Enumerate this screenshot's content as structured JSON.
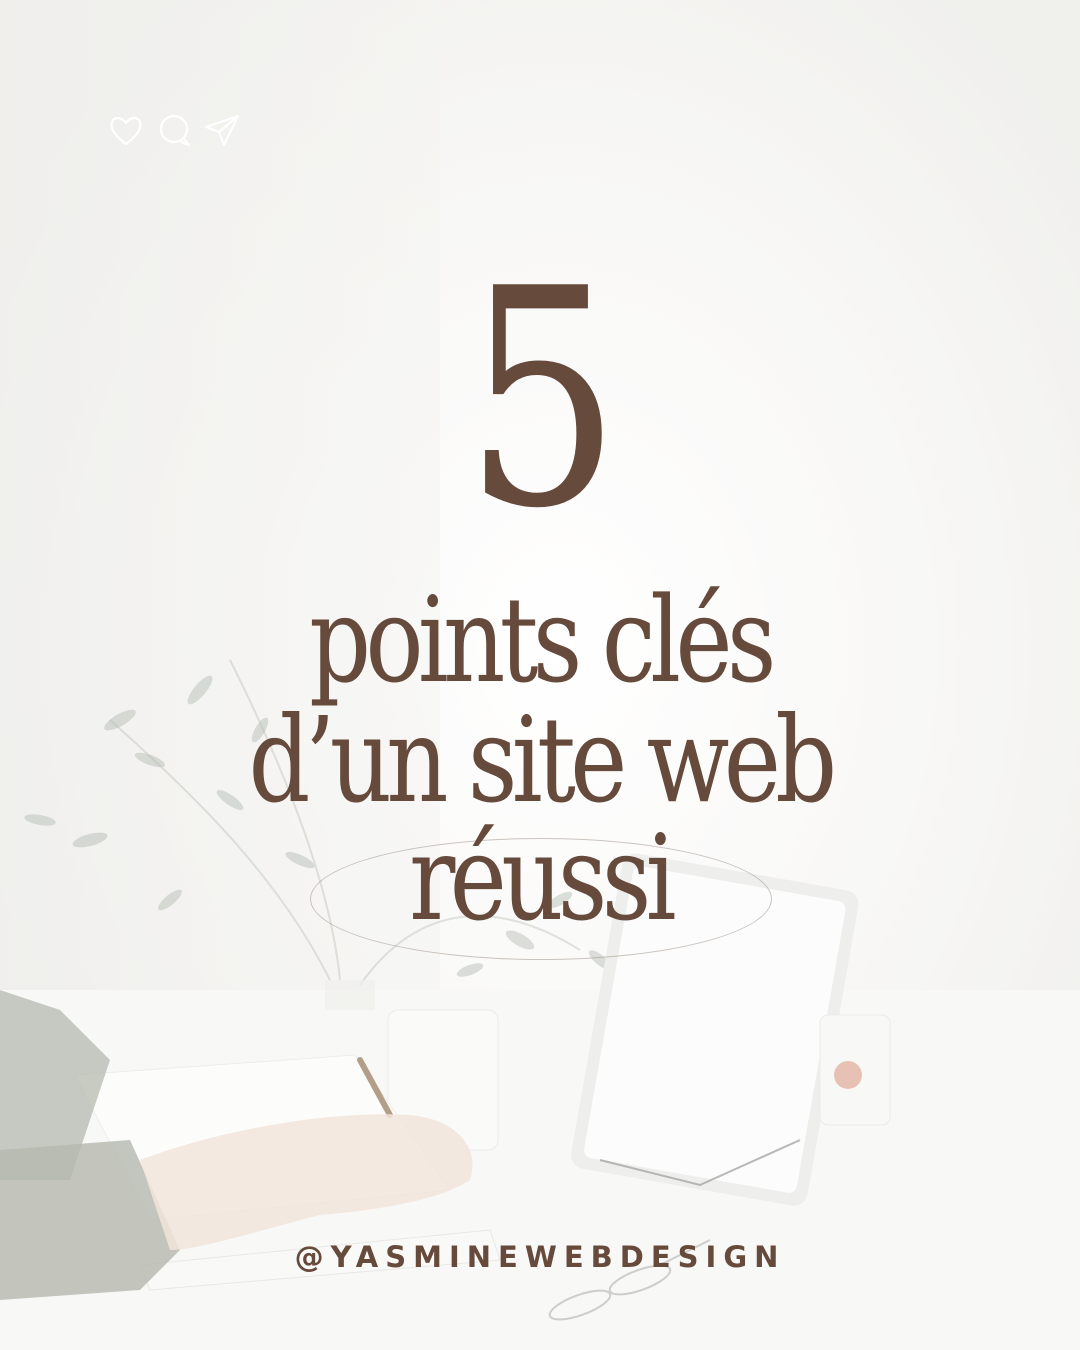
{
  "post": {
    "number": "5",
    "title_lines": [
      "points clés",
      "d’un site web",
      "réussi"
    ],
    "handle": "@YASMINEWEBDESIGN"
  },
  "icons": [
    "heart-icon",
    "comment-icon",
    "send-icon"
  ],
  "colors": {
    "text_brown": "#664a3c",
    "background": "#f3f2ef",
    "icon_stroke": "#ffffff"
  }
}
